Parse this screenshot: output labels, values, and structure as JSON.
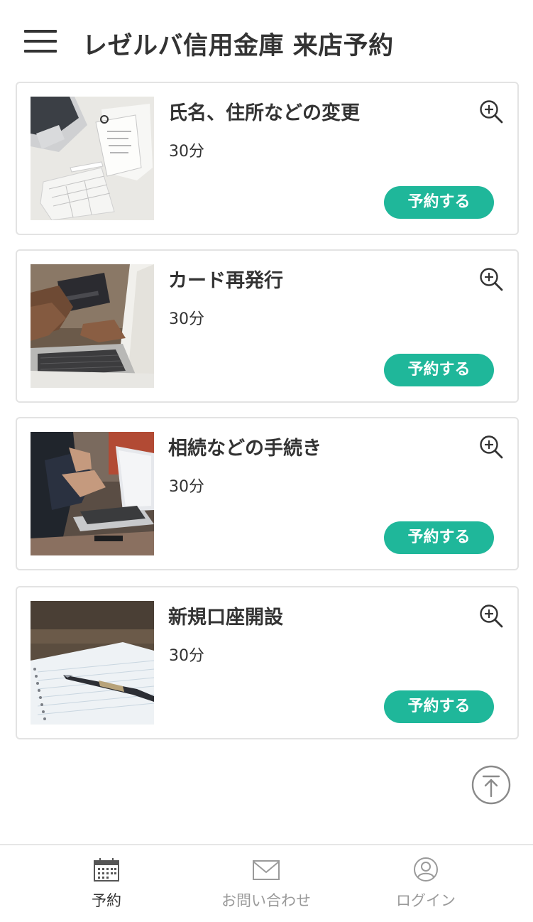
{
  "header": {
    "title": "レゼルバ信用金庫 来店予約",
    "menu_icon": "hamburger-menu-icon"
  },
  "services": [
    {
      "title": "氏名、住所などの変更",
      "duration": "30分",
      "button_label": "予約する",
      "image": "desk-paperwork-photo"
    },
    {
      "title": "カード再発行",
      "duration": "30分",
      "button_label": "予約する",
      "image": "credit-card-laptop-photo"
    },
    {
      "title": "相続などの手続き",
      "duration": "30分",
      "button_label": "予約する",
      "image": "business-meeting-laptop-photo"
    },
    {
      "title": "新規口座開設",
      "duration": "30分",
      "button_label": "予約する",
      "image": "notebook-fountain-pen-photo"
    }
  ],
  "bottom_nav": [
    {
      "label": "予約",
      "icon": "calendar-icon",
      "active": true
    },
    {
      "label": "お問い合わせ",
      "icon": "envelope-icon",
      "active": false
    },
    {
      "label": "ログイン",
      "icon": "user-icon",
      "active": false
    }
  ],
  "colors": {
    "accent": "#1fb79a",
    "text": "#333333",
    "inactive": "#9a9a9a",
    "border": "#e3e3e3"
  }
}
